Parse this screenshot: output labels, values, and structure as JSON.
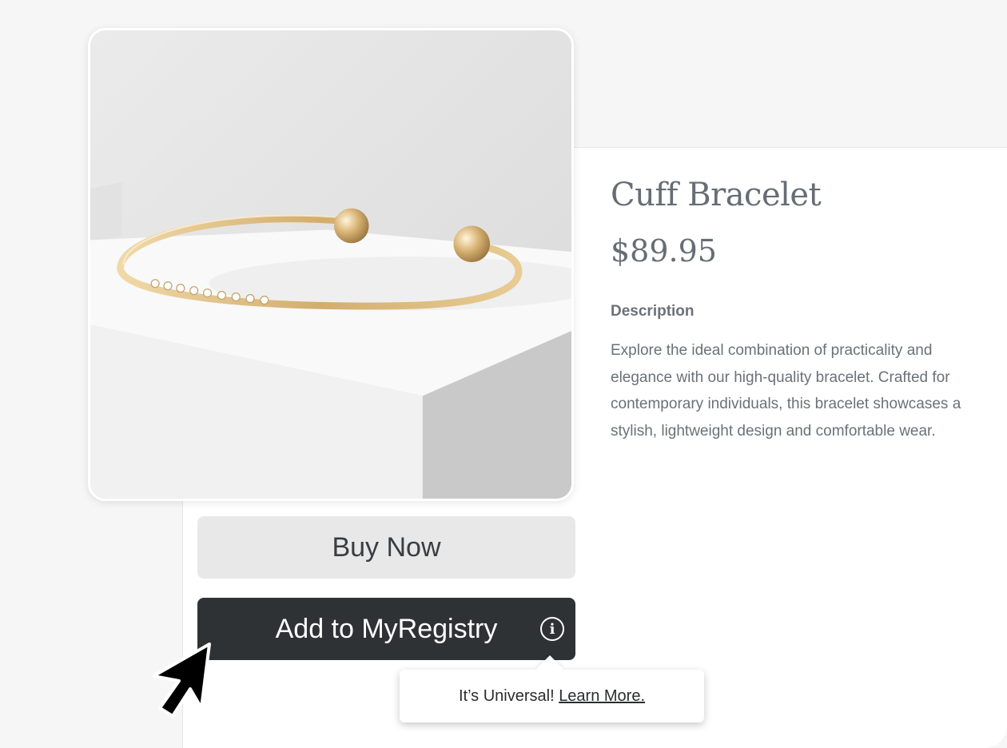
{
  "product": {
    "title": "Cuff Bracelet",
    "price": "$89.95",
    "description_heading": "Description",
    "description": "Explore the ideal combination of practicality and elegance with our high-quality bracelet. Crafted for contemporary individuals, this bracelet showcases a stylish, lightweight design and comfortable wear."
  },
  "actions": {
    "buy_now_label": "Buy Now",
    "add_registry_label": "Add to MyRegistry"
  },
  "tooltip": {
    "text": "It’s Universal!",
    "link_label": "Learn More."
  },
  "icons": {
    "info": "info-icon",
    "cursor": "cursor-arrow-icon"
  },
  "colors": {
    "registry_button": "#2f3234",
    "buy_button": "#e8e8e8",
    "text_muted": "#6b7178",
    "gold": "#d9b67a"
  }
}
